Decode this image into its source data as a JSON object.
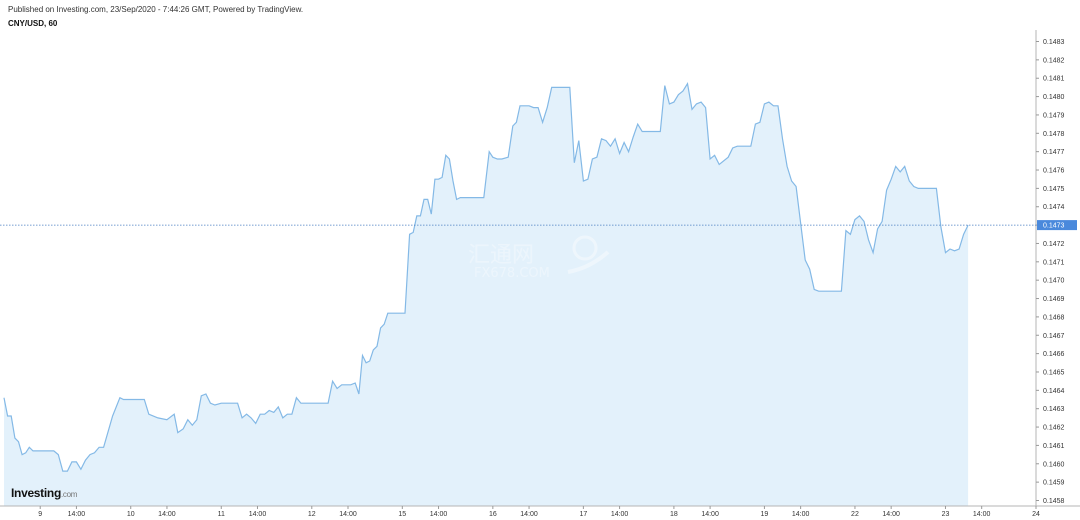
{
  "header": {
    "published": "Published on Investing.com, 23/Sep/2020 - 7:44:26 GMT, Powered by TradingView.",
    "symbol": "CNY/USD, 60"
  },
  "logo": {
    "main": "Investing",
    "suffix": ".com"
  },
  "watermark": {
    "line1": "汇通网",
    "line2": "FX678.COM"
  },
  "chart_data": {
    "type": "area",
    "title": "",
    "xlabel": "",
    "ylabel": "",
    "ylim": [
      0.14577,
      0.14833
    ],
    "y_ticks": [
      "0.1483",
      "0.1482",
      "0.1481",
      "0.1480",
      "0.1479",
      "0.1478",
      "0.1477",
      "0.1476",
      "0.1475",
      "0.1474",
      "0.1473",
      "0.1472",
      "0.1471",
      "0.1470",
      "0.1469",
      "0.1468",
      "0.1467",
      "0.1466",
      "0.1465",
      "0.1464",
      "0.1463",
      "0.1462",
      "0.1461",
      "0.1460",
      "0.1459",
      "0.1458"
    ],
    "x_ticks": [
      {
        "label": "9",
        "x": 4
      },
      {
        "label": "14:00",
        "x": 8
      },
      {
        "label": "10",
        "x": 14
      },
      {
        "label": "14:00",
        "x": 18
      },
      {
        "label": "11",
        "x": 24
      },
      {
        "label": "14:00",
        "x": 28
      },
      {
        "label": "12",
        "x": 34
      },
      {
        "label": "14:00",
        "x": 38
      },
      {
        "label": "15",
        "x": 44
      },
      {
        "label": "14:00",
        "x": 48
      },
      {
        "label": "16",
        "x": 54
      },
      {
        "label": "14:00",
        "x": 58
      },
      {
        "label": "17",
        "x": 64
      },
      {
        "label": "14:00",
        "x": 68
      },
      {
        "label": "18",
        "x": 74
      },
      {
        "label": "14:00",
        "x": 78
      },
      {
        "label": "19",
        "x": 84
      },
      {
        "label": "14:00",
        "x": 88
      },
      {
        "label": "22",
        "x": 94
      },
      {
        "label": "14:00",
        "x": 98
      },
      {
        "label": "23",
        "x": 104
      },
      {
        "label": "14:00",
        "x": 108
      },
      {
        "label": "24",
        "x": 114
      }
    ],
    "x_range": [
      0,
      114
    ],
    "last_value": "0.1473",
    "last_value_raw": 0.1473,
    "series": [
      {
        "color": "#84b9e6",
        "fill": "#e3f1fb",
        "points": [
          [
            0,
            0.14636
          ],
          [
            0.4,
            0.14626
          ],
          [
            0.8,
            0.14626
          ],
          [
            1.2,
            0.14614
          ],
          [
            1.6,
            0.14612
          ],
          [
            2.0,
            0.14605
          ],
          [
            2.4,
            0.14606
          ],
          [
            2.8,
            0.14609
          ],
          [
            3.2,
            0.14607
          ],
          [
            3.6,
            0.14607
          ],
          [
            4.5,
            0.14607
          ],
          [
            5.5,
            0.14607
          ],
          [
            6.0,
            0.14605
          ],
          [
            6.5,
            0.14596
          ],
          [
            7.0,
            0.14596
          ],
          [
            7.5,
            0.14601
          ],
          [
            8.0,
            0.14601
          ],
          [
            8.5,
            0.14597
          ],
          [
            9.0,
            0.14602
          ],
          [
            9.5,
            0.14605
          ],
          [
            10.0,
            0.14606
          ],
          [
            10.5,
            0.14609
          ],
          [
            11.0,
            0.14609
          ],
          [
            12.0,
            0.14626
          ],
          [
            12.8,
            0.14636
          ],
          [
            13.2,
            0.14635
          ],
          [
            14.5,
            0.14635
          ],
          [
            15.5,
            0.14635
          ],
          [
            16.0,
            0.14627
          ],
          [
            17.0,
            0.14625
          ],
          [
            18.0,
            0.14624
          ],
          [
            18.8,
            0.14627
          ],
          [
            19.2,
            0.14617
          ],
          [
            19.8,
            0.14619
          ],
          [
            20.3,
            0.14624
          ],
          [
            20.8,
            0.14621
          ],
          [
            21.3,
            0.14624
          ],
          [
            21.8,
            0.14637
          ],
          [
            22.3,
            0.14638
          ],
          [
            22.8,
            0.14633
          ],
          [
            23.3,
            0.14632
          ],
          [
            24.0,
            0.14633
          ],
          [
            25.0,
            0.14633
          ],
          [
            25.8,
            0.14633
          ],
          [
            26.3,
            0.14625
          ],
          [
            26.8,
            0.14627
          ],
          [
            27.3,
            0.14625
          ],
          [
            27.8,
            0.14622
          ],
          [
            28.3,
            0.14627
          ],
          [
            28.8,
            0.14627
          ],
          [
            29.3,
            0.14629
          ],
          [
            29.8,
            0.14628
          ],
          [
            30.3,
            0.14631
          ],
          [
            30.8,
            0.14625
          ],
          [
            31.3,
            0.14627
          ],
          [
            31.8,
            0.14627
          ],
          [
            32.3,
            0.14636
          ],
          [
            32.8,
            0.14633
          ],
          [
            33.3,
            0.14633
          ],
          [
            34.0,
            0.14633
          ],
          [
            35.0,
            0.14633
          ],
          [
            35.8,
            0.14633
          ],
          [
            36.3,
            0.14645
          ],
          [
            36.8,
            0.14641
          ],
          [
            37.3,
            0.14643
          ],
          [
            37.8,
            0.14643
          ],
          [
            38.3,
            0.14643
          ],
          [
            38.8,
            0.14644
          ],
          [
            39.2,
            0.14638
          ],
          [
            39.6,
            0.14659
          ],
          [
            40.0,
            0.14655
          ],
          [
            40.4,
            0.14656
          ],
          [
            40.8,
            0.14662
          ],
          [
            41.2,
            0.14664
          ],
          [
            41.6,
            0.14674
          ],
          [
            42.0,
            0.14676
          ],
          [
            42.4,
            0.14682
          ],
          [
            42.8,
            0.14682
          ],
          [
            43.3,
            0.14682
          ],
          [
            43.8,
            0.14682
          ],
          [
            44.3,
            0.14682
          ],
          [
            44.8,
            0.14725
          ],
          [
            45.2,
            0.14726
          ],
          [
            45.6,
            0.14735
          ],
          [
            46.0,
            0.14735
          ],
          [
            46.4,
            0.14744
          ],
          [
            46.8,
            0.14744
          ],
          [
            47.2,
            0.14736
          ],
          [
            47.6,
            0.14755
          ],
          [
            48.0,
            0.14755
          ],
          [
            48.4,
            0.14756
          ],
          [
            48.8,
            0.14768
          ],
          [
            49.2,
            0.14766
          ],
          [
            49.6,
            0.14754
          ],
          [
            50.0,
            0.14744
          ],
          [
            50.4,
            0.14745
          ],
          [
            51.0,
            0.14745
          ],
          [
            52.0,
            0.14745
          ],
          [
            53.0,
            0.14745
          ],
          [
            53.6,
            0.1477
          ],
          [
            54.0,
            0.14767
          ],
          [
            54.5,
            0.14766
          ],
          [
            55.0,
            0.14766
          ],
          [
            55.7,
            0.14767
          ],
          [
            56.2,
            0.14784
          ],
          [
            56.6,
            0.14786
          ],
          [
            57.0,
            0.14795
          ],
          [
            57.5,
            0.14795
          ],
          [
            58.0,
            0.14795
          ],
          [
            58.5,
            0.14794
          ],
          [
            59.0,
            0.14794
          ],
          [
            59.5,
            0.14786
          ],
          [
            60.0,
            0.14794
          ],
          [
            60.5,
            0.14805
          ],
          [
            61.0,
            0.14805
          ],
          [
            62.0,
            0.14805
          ],
          [
            62.5,
            0.14805
          ],
          [
            63.0,
            0.14764
          ],
          [
            63.5,
            0.14776
          ],
          [
            64.0,
            0.14754
          ],
          [
            64.5,
            0.14755
          ],
          [
            65.0,
            0.14766
          ],
          [
            65.5,
            0.14767
          ],
          [
            66.0,
            0.14777
          ],
          [
            66.5,
            0.14776
          ],
          [
            67.0,
            0.14773
          ],
          [
            67.5,
            0.14777
          ],
          [
            68.0,
            0.14769
          ],
          [
            68.5,
            0.14775
          ],
          [
            69.0,
            0.1477
          ],
          [
            69.5,
            0.14778
          ],
          [
            70.0,
            0.14785
          ],
          [
            70.5,
            0.14781
          ],
          [
            71.0,
            0.14781
          ],
          [
            72.0,
            0.14781
          ],
          [
            72.5,
            0.14781
          ],
          [
            73.0,
            0.14806
          ],
          [
            73.5,
            0.14796
          ],
          [
            74.0,
            0.14797
          ],
          [
            74.5,
            0.14801
          ],
          [
            75.0,
            0.14803
          ],
          [
            75.5,
            0.14807
          ],
          [
            76.0,
            0.14793
          ],
          [
            76.5,
            0.14796
          ],
          [
            77.0,
            0.14797
          ],
          [
            77.5,
            0.14794
          ],
          [
            78.0,
            0.14766
          ],
          [
            78.5,
            0.14768
          ],
          [
            79.0,
            0.14763
          ],
          [
            80.0,
            0.14767
          ],
          [
            80.5,
            0.14772
          ],
          [
            81.0,
            0.14773
          ],
          [
            82.0,
            0.14773
          ],
          [
            82.5,
            0.14773
          ],
          [
            83.0,
            0.14785
          ],
          [
            83.5,
            0.14786
          ],
          [
            84.0,
            0.14796
          ],
          [
            84.5,
            0.14797
          ],
          [
            85.0,
            0.14795
          ],
          [
            85.5,
            0.14795
          ],
          [
            86.0,
            0.14777
          ],
          [
            86.5,
            0.14762
          ],
          [
            87.0,
            0.14754
          ],
          [
            87.5,
            0.14751
          ],
          [
            88.5,
            0.14711
          ],
          [
            89.0,
            0.14706
          ],
          [
            89.5,
            0.14695
          ],
          [
            90.0,
            0.14694
          ],
          [
            91.0,
            0.14694
          ],
          [
            92.0,
            0.14694
          ],
          [
            92.5,
            0.14694
          ],
          [
            93.0,
            0.14727
          ],
          [
            93.5,
            0.14725
          ],
          [
            94.0,
            0.14733
          ],
          [
            94.5,
            0.14735
          ],
          [
            95.0,
            0.14732
          ],
          [
            95.5,
            0.14722
          ],
          [
            96.0,
            0.14715
          ],
          [
            96.5,
            0.14728
          ],
          [
            97.0,
            0.14732
          ],
          [
            97.5,
            0.14749
          ],
          [
            98.0,
            0.14755
          ],
          [
            98.5,
            0.14762
          ],
          [
            99.0,
            0.14759
          ],
          [
            99.5,
            0.14762
          ],
          [
            100.0,
            0.14754
          ],
          [
            100.5,
            0.14751
          ],
          [
            101.0,
            0.1475
          ],
          [
            102.0,
            0.1475
          ],
          [
            102.5,
            0.1475
          ],
          [
            103.0,
            0.1475
          ],
          [
            103.5,
            0.14729
          ],
          [
            104.0,
            0.14715
          ],
          [
            104.5,
            0.14717
          ],
          [
            105.0,
            0.14716
          ],
          [
            105.5,
            0.14717
          ],
          [
            106.0,
            0.14725
          ],
          [
            106.5,
            0.1473
          ]
        ]
      }
    ]
  }
}
